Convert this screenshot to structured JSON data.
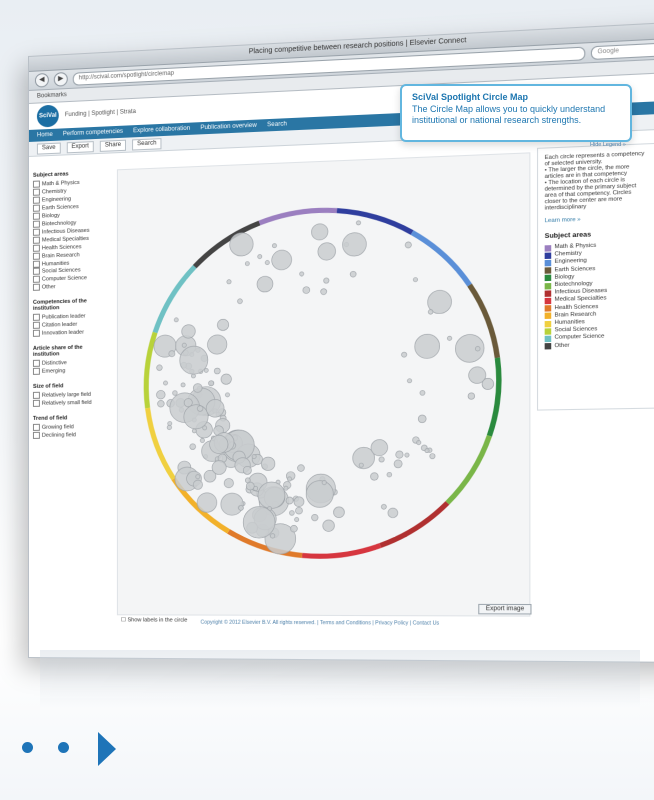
{
  "browser": {
    "window_title": "Placing competitive between research positions | Elsevier Connect",
    "url": "http://scival.com/spotlight/circlemap",
    "search_placeholder": "Google",
    "bookmarks": "Bookmarks"
  },
  "site": {
    "logo": "SciVal",
    "crumbs": "Funding | Spotlight | Strata",
    "nav": [
      "Home",
      "Perform competencies",
      "Explore collaboration",
      "Publication overview",
      "Search"
    ],
    "actions": [
      "Save",
      "Export",
      "Share",
      "Search"
    ]
  },
  "filters": {
    "subject_header": "Subject areas",
    "subjects": [
      "Math & Physics",
      "Chemistry",
      "Engineering",
      "Earth Sciences",
      "Biology",
      "Biotechnology",
      "Infectious Diseases",
      "Medical Specialties",
      "Health Sciences",
      "Brain Research",
      "Humanities",
      "Social Sciences",
      "Computer Science",
      "Other"
    ],
    "institution_header": "Competencies of the institution",
    "institution_opts": [
      "Publication leader",
      "Citation leader",
      "Innovation leader"
    ],
    "article_header": "Article share of the institution",
    "article_opts": [
      "Distinctive",
      "Emerging"
    ],
    "size_header": "Size of field",
    "size_opts": [
      "Relatively large field",
      "Relatively small field"
    ],
    "trend_header": "Trend of field",
    "trend_opts": [
      "Growing field",
      "Declining field"
    ]
  },
  "legend": {
    "intro": "Each circle represents a competency of selected university.",
    "bullets": [
      "The larger the circle, the more articles are in that competency",
      "The location of each circle is determined by the primary subject area of that competency. Circles closer to the center are more interdisciplinary"
    ],
    "learn_more": "Learn more »",
    "subject_title": "Subject areas",
    "items": [
      {
        "label": "Math & Physics",
        "color": "#9b7fc0"
      },
      {
        "label": "Chemistry",
        "color": "#2f3e9e"
      },
      {
        "label": "Engineering",
        "color": "#5a8fd8"
      },
      {
        "label": "Earth Sciences",
        "color": "#6a5a3a"
      },
      {
        "label": "Biology",
        "color": "#2a8a3e"
      },
      {
        "label": "Biotechnology",
        "color": "#7ab648"
      },
      {
        "label": "Infectious Diseases",
        "color": "#b03030"
      },
      {
        "label": "Medical Specialties",
        "color": "#d6363f"
      },
      {
        "label": "Health Sciences",
        "color": "#e07a2a"
      },
      {
        "label": "Brain Research",
        "color": "#f2b12a"
      },
      {
        "label": "Humanities",
        "color": "#f0d040"
      },
      {
        "label": "Social Sciences",
        "color": "#b8d23a"
      },
      {
        "label": "Computer Science",
        "color": "#6fc1c4"
      },
      {
        "label": "Other",
        "color": "#444444"
      }
    ]
  },
  "callout": {
    "title": "SciVal Spotlight Circle Map",
    "body": "The Circle Map allows you to quickly understand institutional or national research strengths."
  },
  "misc": {
    "hide_legend": "Hide Legend »",
    "show_labels": "Show labels in the circle",
    "export": "Export image",
    "footer": "Copyright © 2012 Elsevier B.V. All rights reserved.  |  Terms and Conditions  |  Privacy Policy  |  Contact Us"
  }
}
